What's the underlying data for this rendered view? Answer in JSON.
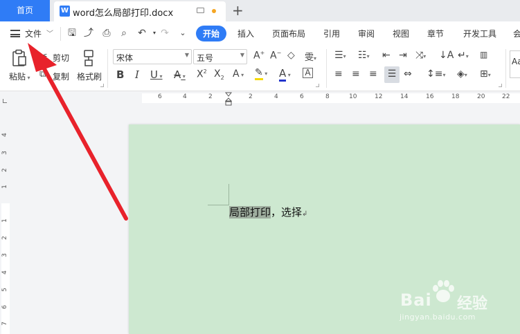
{
  "tabs": {
    "home": "首页",
    "document": "word怎么局部打印.docx",
    "doc_icon_letter": "W"
  },
  "menubar": {
    "file": "文件",
    "tabs": [
      "开始",
      "插入",
      "页面布局",
      "引用",
      "审阅",
      "视图",
      "章节",
      "开发工具",
      "会"
    ],
    "active_tab": "开始"
  },
  "ribbon": {
    "paste": "粘贴",
    "cut": "剪切",
    "copy": "复制",
    "format_painter": "格式刷",
    "font_name": "宋体",
    "font_size": "五号",
    "style_preview": "Aa"
  },
  "ruler": {
    "top_numbers": [
      "6",
      "4",
      "2",
      "2",
      "4",
      "6",
      "8",
      "10",
      "12",
      "14",
      "16",
      "18",
      "20",
      "22"
    ],
    "left_numbers": [
      "4",
      "3",
      "2",
      "1",
      "1",
      "2",
      "3",
      "4",
      "5",
      "6",
      "7"
    ]
  },
  "document": {
    "selected_text": "局部打印",
    "rest_text": "，选择"
  },
  "watermark": {
    "brand": "Bai",
    "brand_cn": "经验",
    "url": "jingyan.baidu.com"
  },
  "colors": {
    "accent": "#2f7cf6",
    "page_bg": "#cde8d0",
    "selection": "#9fae9f",
    "arrow": "#e8222b"
  }
}
